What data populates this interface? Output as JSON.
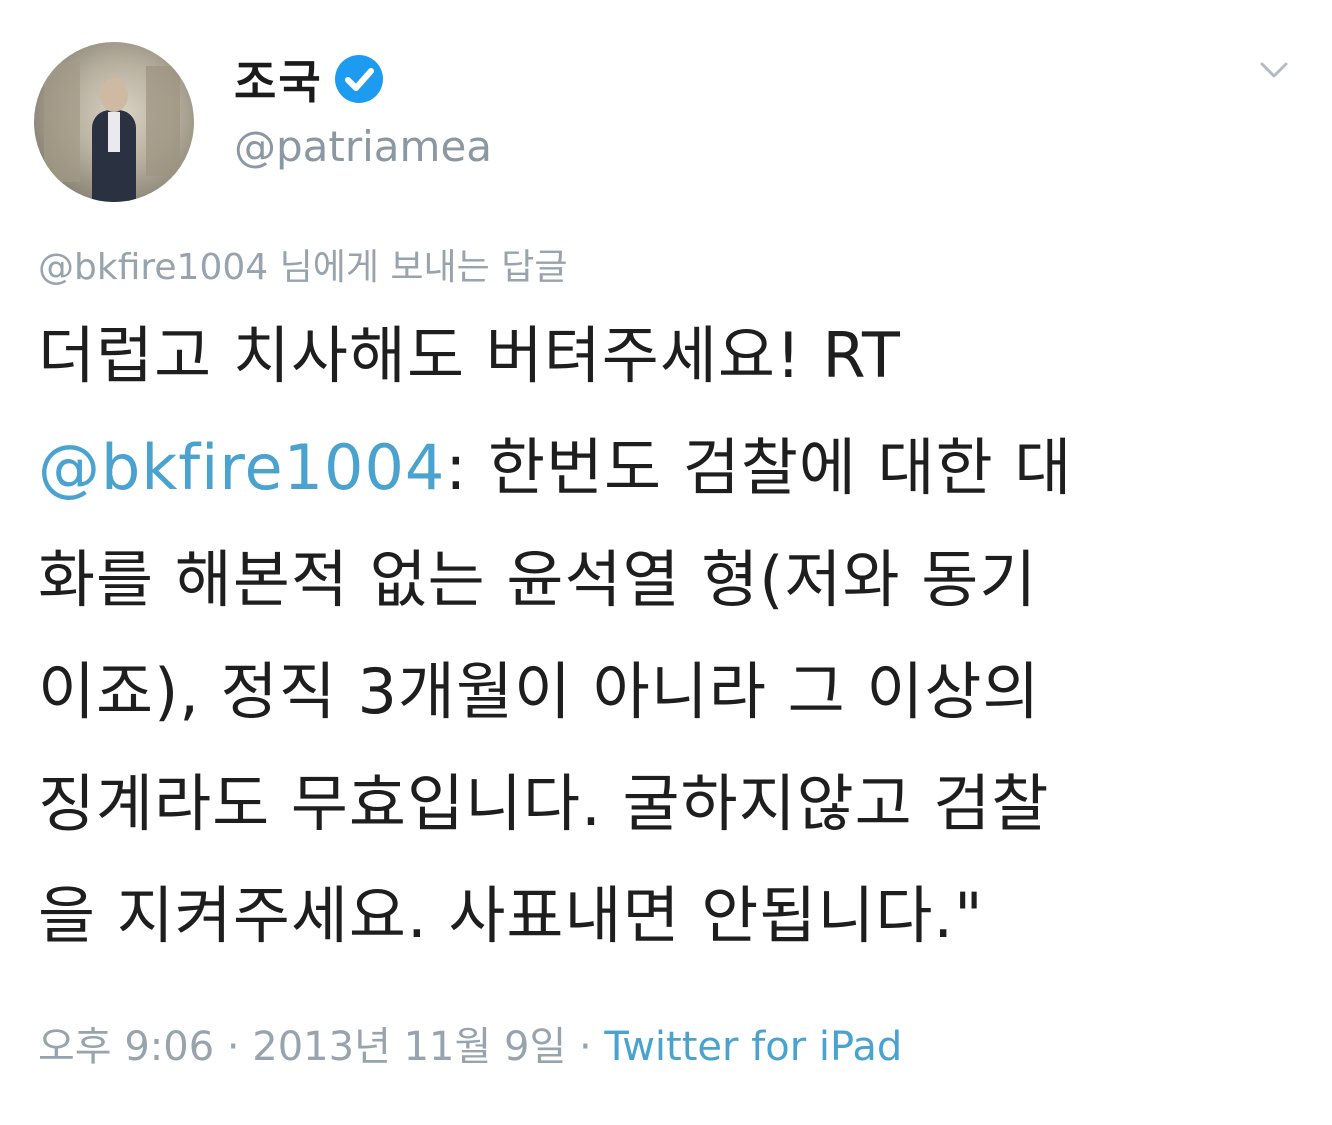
{
  "user": {
    "display_name": "조국",
    "handle": "@patriamea"
  },
  "reply_context": {
    "mention": "@bkfire1004",
    "suffix": "님에게 보내는 답글"
  },
  "tweet": {
    "line1": "더럽고 치사해도 버텨주세요! RT",
    "line2_mention": "@bkfire1004",
    "line2_text": ": 한번도 검찰에 대한 대",
    "line3": "화를 해본적 없는 윤석열 형(저와 동기",
    "line4": "이죠), 정직 3개월이 아니라 그 이상의",
    "line5": "징계라도 무효입니다. 굴하지않고 검찰",
    "line6": "을 지켜주세요. 사표내면 안됩니다.\""
  },
  "meta": {
    "timestamp": "오후 9:06 · 2013년 11월 9일 ·",
    "source": "Twitter for iPad"
  },
  "colors": {
    "link": "#4aa3cf",
    "verified": "#1d9bf0",
    "muted": "#97a3ad"
  },
  "icons": {
    "verified": "verified-badge-icon",
    "menu": "chevron-down-icon"
  }
}
